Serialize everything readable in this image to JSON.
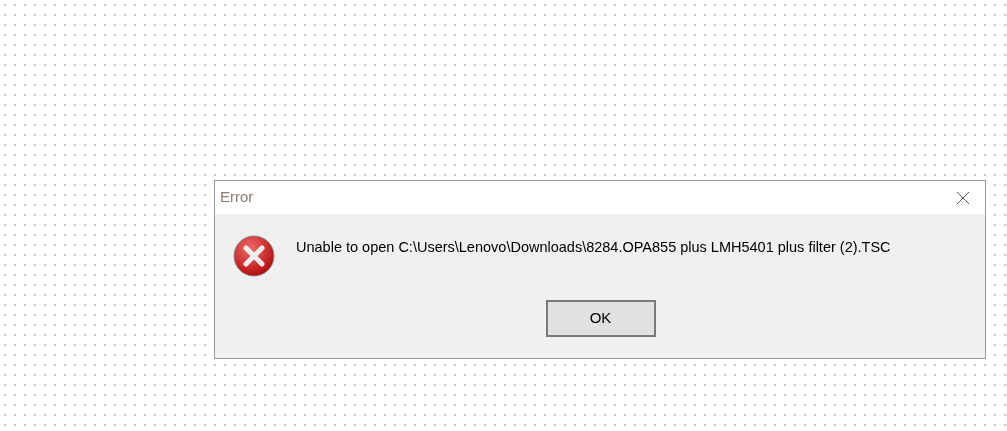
{
  "dialog": {
    "title": "Error",
    "message": "Unable to open C:\\Users\\Lenovo\\Downloads\\8284.OPA855 plus LMH5401 plus filter (2).TSC",
    "buttons": [
      "OK"
    ]
  }
}
